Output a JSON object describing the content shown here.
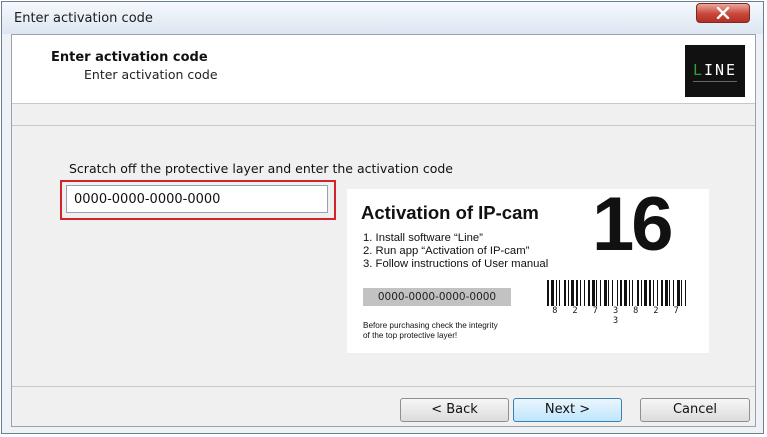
{
  "window": {
    "title": "Enter activation code",
    "close_icon": "close-icon"
  },
  "header": {
    "title": "Enter activation code",
    "subtitle": "Enter activation code",
    "logo": {
      "text": "LINE",
      "colors": {
        "background": "#111111",
        "letter": "#ffffff",
        "accent": "#2aa23a"
      }
    }
  },
  "main": {
    "instruction": "Scratch off the protective layer and enter the activation code",
    "code_input": {
      "value": "0000-0000-0000-0000",
      "placeholder": ""
    },
    "card": {
      "title": "Activation of IP-cam",
      "number": "16",
      "steps": [
        "1. Install software “Line”",
        "2. Run app “Activation of IP-cam”",
        "3. Follow instructions of User manual"
      ],
      "scratch_code": "0000-0000-0000-0000",
      "barcode_digits": "8 2 7 3 8 2 7 3",
      "warning": [
        "Before purchasing check the integrity",
        "of the top protective layer!"
      ]
    }
  },
  "buttons": {
    "back": "< Back",
    "next": "Next >",
    "cancel": "Cancel"
  },
  "colors": {
    "highlight": "#d2232a",
    "default_button_border": "#3c7fb1"
  }
}
